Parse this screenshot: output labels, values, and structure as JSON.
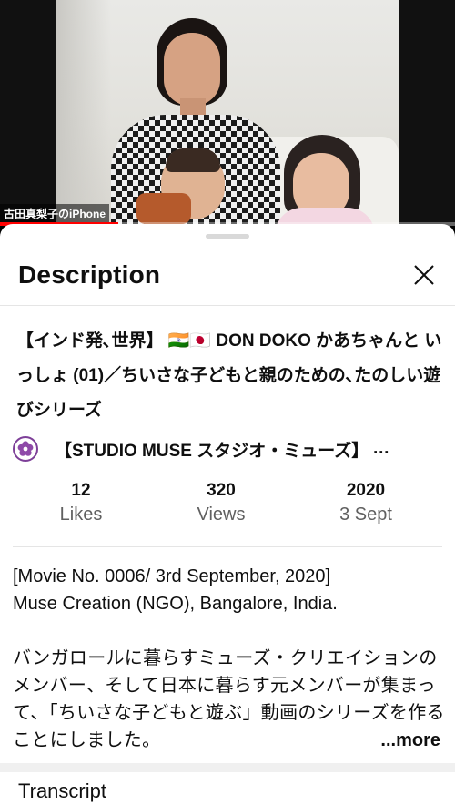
{
  "video": {
    "overlay_name": "古田真梨子のiPhone",
    "progress": 0.26
  },
  "sheet": {
    "title": "Description",
    "close_icon": "close-icon"
  },
  "video_info": {
    "title": "【インド発､世界】 🇮🇳🇯🇵 DON DOKO かあちゃんと いっしょ (01)／ちいさな子どもと親のための､たのしい遊びシリーズ",
    "channel_name": "【STUDIO MUSE スタジオ・ミューズ】",
    "channel_ellipsis": "…",
    "stats": {
      "likes_value": "12",
      "likes_label": "Likes",
      "views_value": "320",
      "views_label": "Views",
      "year": "2020",
      "date": "3 Sept"
    }
  },
  "description": {
    "line1": "[Movie No. 0006/ 3rd September, 2020]",
    "line2": "Muse Creation (NGO),  Bangalore, India.",
    "japanese": "バンガロールに暮らすミューズ・クリエイションのメンバー、そして日本に暮らす元メンバーが集まって、「ちいさな子どもと遊ぶ」動画のシリーズを作ることにしました。",
    "more_label": "...more"
  },
  "transcript": {
    "label": "Transcript"
  },
  "colors": {
    "accent": "#ff0000",
    "channel_ring": "#7d3f98"
  }
}
